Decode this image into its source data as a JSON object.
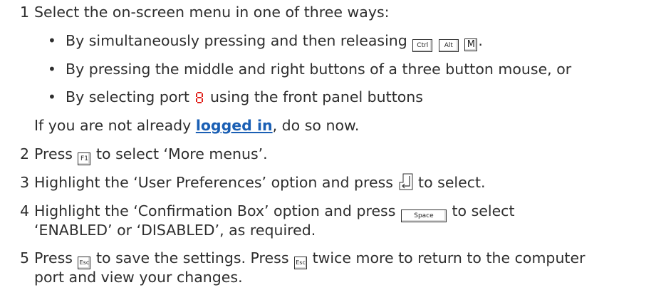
{
  "steps": [
    {
      "num": "1",
      "text": "Select the on-screen menu in one of three ways:"
    },
    {
      "num": "2",
      "pre": "Press",
      "key": "F1",
      "post": "to select ‘More menus’."
    },
    {
      "num": "3",
      "pre": "Highlight the ‘User Preferences’ option and press",
      "post": "to select."
    },
    {
      "num": "4",
      "pre": "Highlight the ‘Confirmation Box’ option and press",
      "key": "Space",
      "post": "to select",
      "line2": "‘ENABLED’ or ‘DISABLED’, as required."
    },
    {
      "num": "5",
      "pre": "Press",
      "key": "Esc",
      "mid": "to save the settings. Press",
      "post": "twice more to return to the computer",
      "line2": "port and view your changes."
    }
  ],
  "bullets": [
    {
      "pre": "By simultaneously pressing and then releasing",
      "keys": [
        "Ctrl",
        "Alt",
        "M"
      ],
      "post": "."
    },
    {
      "text": "By pressing the middle and right buttons of a three button mouse, or"
    },
    {
      "pre": "By selecting port",
      "post": "using the front panel buttons"
    }
  ],
  "login_note": {
    "pre": "If you are not already",
    "link": "logged in",
    "post": ", do so now."
  },
  "colors": {
    "link": "#1a5fb4",
    "port_icon": "#e0201b",
    "text": "#2e2e2e"
  },
  "icons": {
    "enter_key": "enter-key-icon",
    "port": "port-display-icon"
  }
}
